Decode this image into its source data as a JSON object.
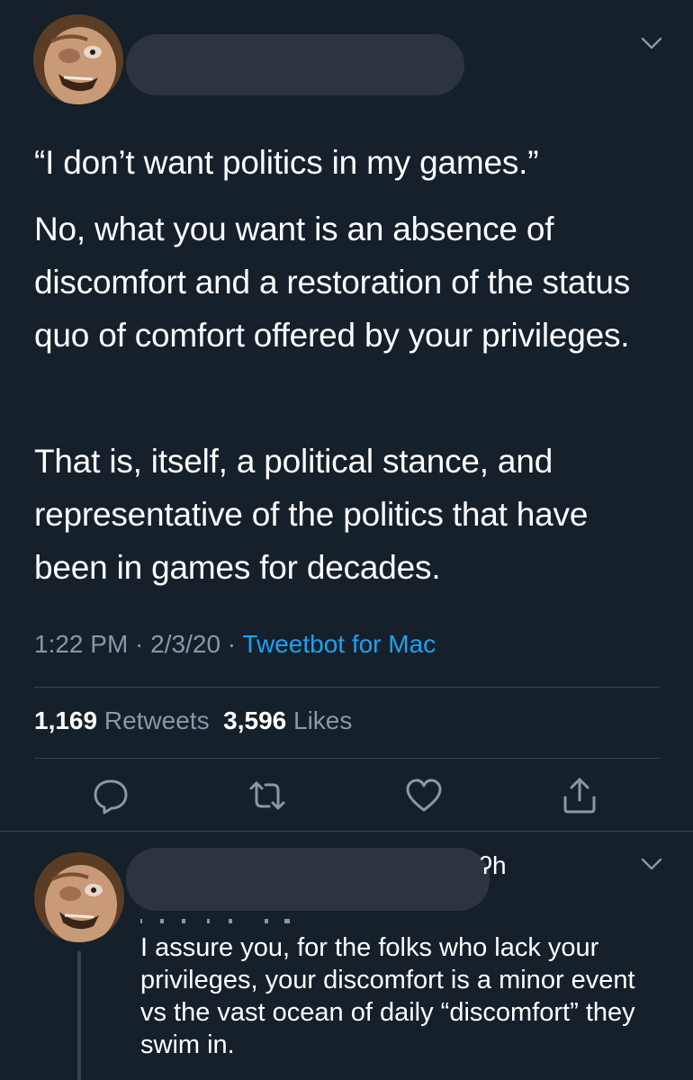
{
  "main_tweet": {
    "author_name": "",
    "paragraphs": [
      "“I don’t want politics in my games.”",
      "No, what you want is an absence of discomfort and a restoration of the status quo of comfort offered by your privileges.",
      "That is, itself, a political stance, and representative of the politics that have been in games for decades."
    ],
    "time": "1:22 PM",
    "sep1": " · ",
    "date": "2/3/20",
    "sep2": " · ",
    "source": "Tweetbot for Mac",
    "retweets_count": "1,169",
    "retweets_label": "Retweets",
    "likes_count": "3,596",
    "likes_label": "Likes",
    "icons": {
      "menu": "chevron-down-icon",
      "reply": "reply-icon",
      "retweet": "retweet-icon",
      "like": "heart-icon",
      "share": "share-icon"
    }
  },
  "reply_tweet": {
    "timestamp_partial": "ʔh",
    "text": "I assure you, for the folks who lack your privileges, your discomfort is a minor event vs the vast ocean of daily “discomfort” they swim in."
  },
  "colors": {
    "background": "#15202b",
    "text": "#ffffff",
    "secondary": "#8899a6",
    "link": "#1da1f2",
    "divider": "#38444d"
  }
}
